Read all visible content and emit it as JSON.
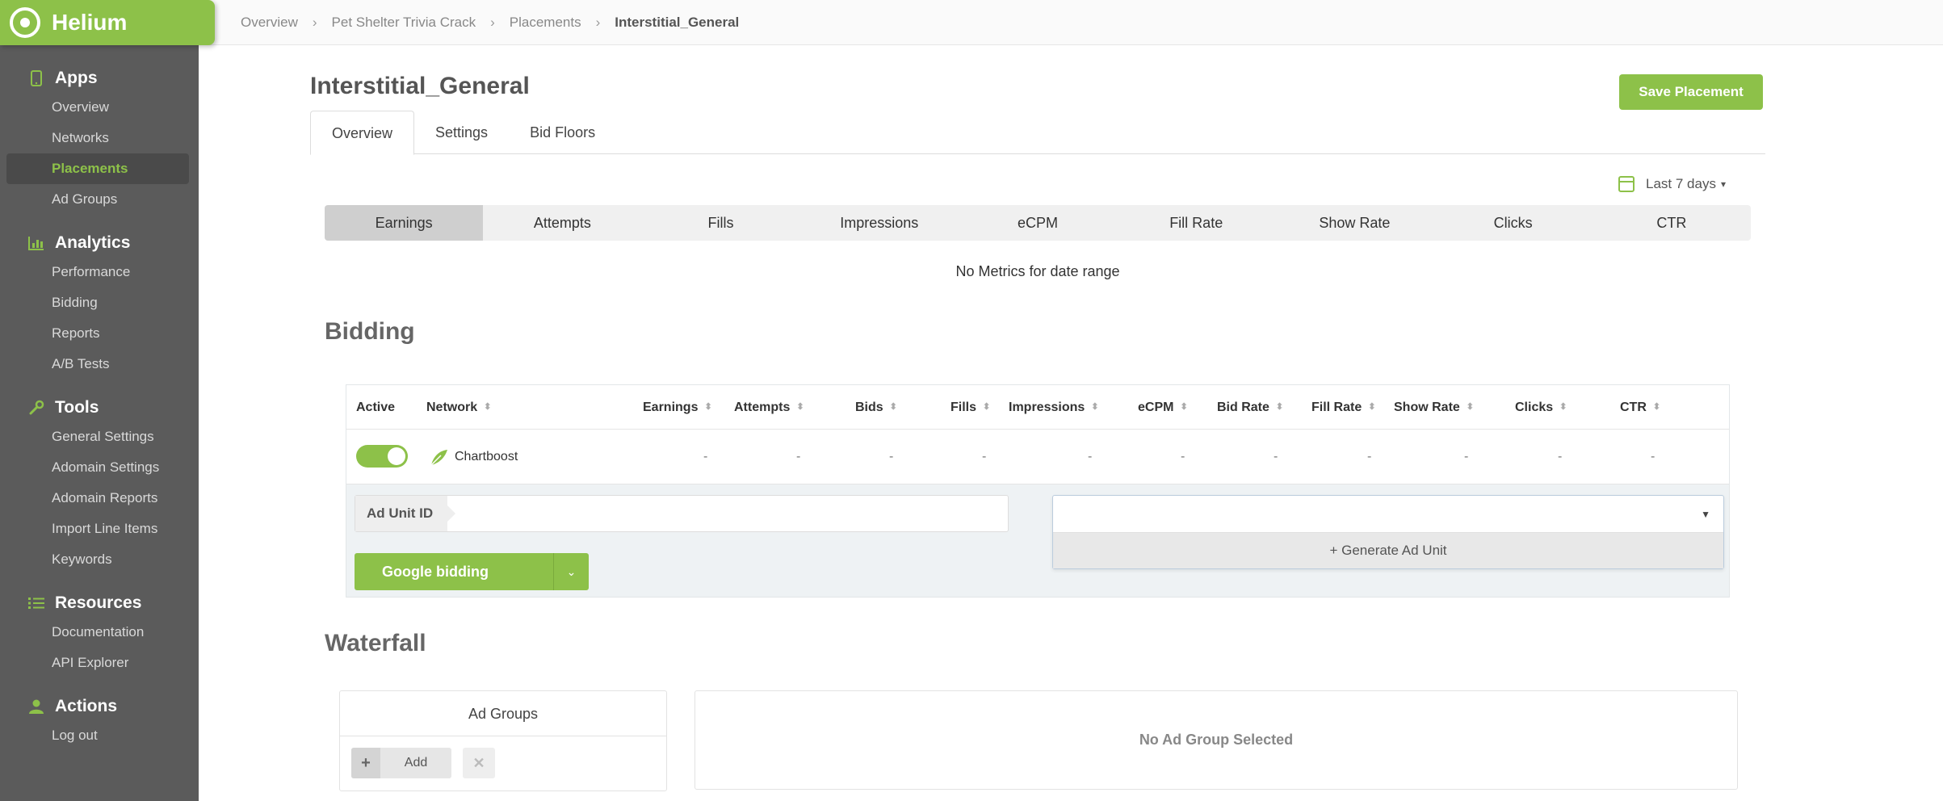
{
  "brand": {
    "name": "Helium",
    "accent": "#8dc149"
  },
  "sidebar": {
    "sections": [
      {
        "title": "Apps",
        "icon": "phone-icon",
        "items": [
          "Overview",
          "Networks",
          "Placements",
          "Ad Groups"
        ]
      },
      {
        "title": "Analytics",
        "icon": "bar-chart-icon",
        "items": [
          "Performance",
          "Bidding",
          "Reports",
          "A/B Tests"
        ]
      },
      {
        "title": "Tools",
        "icon": "wrench-icon",
        "items": [
          "General Settings",
          "Adomain Settings",
          "Adomain Reports",
          "Import Line Items",
          "Keywords"
        ]
      },
      {
        "title": "Resources",
        "icon": "list-icon",
        "items": [
          "Documentation",
          "API Explorer"
        ]
      },
      {
        "title": "Actions",
        "icon": "user-icon",
        "items": [
          "Log out"
        ]
      }
    ],
    "active_item": "Placements"
  },
  "breadcrumb": [
    "Overview",
    "Pet Shelter Trivia Crack",
    "Placements",
    "Interstitial_General"
  ],
  "page": {
    "title": "Interstitial_General",
    "save_label": "Save Placement",
    "tabs": [
      "Overview",
      "Settings",
      "Bid Floors"
    ],
    "date_range": "Last 7 days"
  },
  "metrics": {
    "tabs": [
      "Earnings",
      "Attempts",
      "Fills",
      "Impressions",
      "eCPM",
      "Fill Rate",
      "Show Rate",
      "Clicks",
      "CTR"
    ],
    "empty_message": "No Metrics for date range"
  },
  "bidding": {
    "title": "Bidding",
    "columns": [
      "Active",
      "Network",
      "Earnings",
      "Attempts",
      "Bids",
      "Fills",
      "Impressions",
      "eCPM",
      "Bid Rate",
      "Fill Rate",
      "Show Rate",
      "Clicks",
      "CTR"
    ],
    "row": {
      "network": "Chartboost",
      "values": [
        "-",
        "-",
        "-",
        "-",
        "-",
        "-",
        "-",
        "-",
        "-",
        "-",
        "-"
      ]
    },
    "ad_unit_label": "Ad Unit ID",
    "ad_unit_value": "",
    "bidding_button": "Google bidding",
    "generate_label": "+ Generate Ad Unit"
  },
  "waterfall": {
    "title": "Waterfall",
    "ad_groups_title": "Ad Groups",
    "add_label": "Add",
    "empty_selection": "No Ad Group Selected"
  }
}
